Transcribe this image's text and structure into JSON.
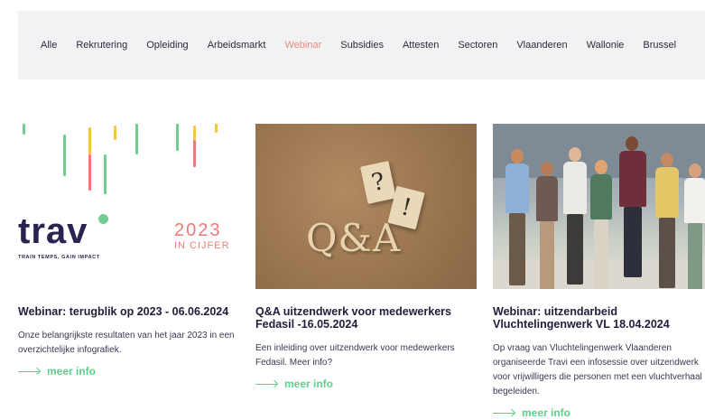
{
  "nav": {
    "items": [
      "Alle",
      "Rekrutering",
      "Opleiding",
      "Arbeidsmarkt",
      "Webinar",
      "Subsidies",
      "Attesten",
      "Sectoren",
      "Vlaanderen",
      "Wallonie",
      "Brussel"
    ],
    "active": "Webinar"
  },
  "colors": {
    "accent_active": "#f08a7e",
    "link_green": "#5fcf8c",
    "title_navy": "#1f1d3a"
  },
  "cards": [
    {
      "image": {
        "logo_text": "trav",
        "tagline": "TRAIN TEMPS, GAIN IMPACT",
        "year": "2023",
        "subtitle": "IN CIJFER"
      },
      "title": "Webinar: terugblik op 2023 - 06.06.2024",
      "description": "Onze belangrijkste resultaten van het jaar 2023 in een overzichtelijke infografiek.",
      "link": "meer info"
    },
    {
      "image": {
        "tile_1": "?",
        "tile_2": "!",
        "text": "Q&A"
      },
      "title": "Q&A uitzendwerk voor medewerkers Fedasil -16.05.2024",
      "description": "Een inleiding over uitzendwerk voor medewerkers Fedasil. Meer info?",
      "link": "meer info"
    },
    {
      "image": {
        "description": "group-photo"
      },
      "title": "Webinar: uitzendarbeid Vluchtelingenwerk VL 18.04.2024",
      "description": "Op vraag van Vluchtelingenwerk Vlaanderen organiseerde Travi een infosessie over uitzendwerk voor vrijwilligers die personen met een vluchtverhaal begeleiden.",
      "link": "meer info"
    }
  ]
}
